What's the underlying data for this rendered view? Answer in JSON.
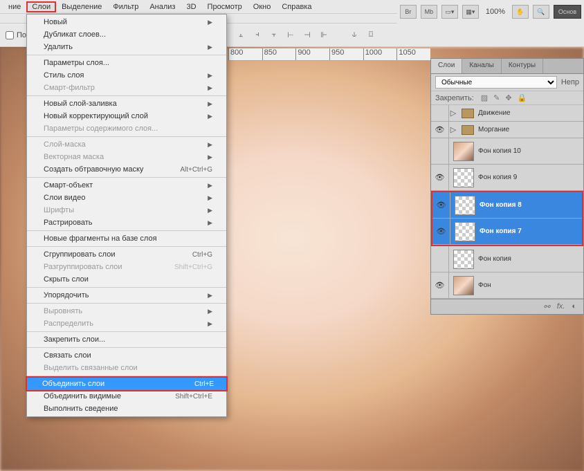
{
  "menubar": {
    "items": [
      "ние",
      "Слои",
      "Выделение",
      "Фильтр",
      "Анализ",
      "3D",
      "Просмотр",
      "Окно",
      "Справка"
    ],
    "active_index": 1
  },
  "toolbar_right": {
    "buttons": [
      "Br",
      "Mb"
    ],
    "zoom": "100%",
    "main_btn": "Основ"
  },
  "second_toolbar": {
    "checkbox_label": "Показ"
  },
  "ruler_ticks": [
    "800",
    "850",
    "900",
    "950",
    "1000",
    "1050"
  ],
  "dropdown": {
    "groups": [
      [
        {
          "label": "Новый",
          "arrow": true
        },
        {
          "label": "Дубликат слоев..."
        },
        {
          "label": "Удалить",
          "arrow": true
        }
      ],
      [
        {
          "label": "Параметры слоя..."
        },
        {
          "label": "Стиль слоя",
          "arrow": true
        },
        {
          "label": "Смарт-фильтр",
          "arrow": true,
          "disabled": true
        }
      ],
      [
        {
          "label": "Новый слой-заливка",
          "arrow": true
        },
        {
          "label": "Новый корректирующий слой",
          "arrow": true
        },
        {
          "label": "Параметры содержимого слоя...",
          "disabled": true
        }
      ],
      [
        {
          "label": "Слой-маска",
          "arrow": true,
          "disabled": true
        },
        {
          "label": "Векторная маска",
          "arrow": true,
          "disabled": true
        },
        {
          "label": "Создать обтравочную маску",
          "shortcut": "Alt+Ctrl+G"
        }
      ],
      [
        {
          "label": "Смарт-объект",
          "arrow": true
        },
        {
          "label": "Слои видео",
          "arrow": true
        },
        {
          "label": "Шрифты",
          "arrow": true,
          "disabled": true
        },
        {
          "label": "Растрировать",
          "arrow": true
        }
      ],
      [
        {
          "label": "Новые фрагменты на базе слоя"
        }
      ],
      [
        {
          "label": "Сгруппировать слои",
          "shortcut": "Ctrl+G"
        },
        {
          "label": "Разгруппировать слои",
          "shortcut": "Shift+Ctrl+G",
          "disabled": true
        },
        {
          "label": "Скрыть слои"
        }
      ],
      [
        {
          "label": "Упорядочить",
          "arrow": true
        }
      ],
      [
        {
          "label": "Выровнять",
          "arrow": true,
          "disabled": true
        },
        {
          "label": "Распределить",
          "arrow": true,
          "disabled": true
        }
      ],
      [
        {
          "label": "Закрепить слои..."
        }
      ],
      [
        {
          "label": "Связать слои"
        },
        {
          "label": "Выделить связанные слои",
          "disabled": true
        }
      ],
      [
        {
          "label": "Объединить слои",
          "shortcut": "Ctrl+E",
          "highlighted": true
        },
        {
          "label": "Объединить видимые",
          "shortcut": "Shift+Ctrl+E"
        },
        {
          "label": "Выполнить сведение"
        }
      ]
    ]
  },
  "layers_panel": {
    "tabs": [
      "Слои",
      "Каналы",
      "Контуры"
    ],
    "blend_mode": "Обычные",
    "opacity_label": "Непр",
    "lock_label": "Закрепить:",
    "layers": [
      {
        "type": "group",
        "name": "Движение",
        "visible": false
      },
      {
        "type": "group",
        "name": "Моргание",
        "visible": true
      },
      {
        "type": "layer",
        "name": "Фон копия 10",
        "thumb": "photo",
        "visible": false
      },
      {
        "type": "layer",
        "name": "Фон копия 9",
        "thumb": "checker",
        "visible": true
      },
      {
        "type": "layer",
        "name": "Фон копия 8",
        "thumb": "checker",
        "visible": true,
        "selected": true
      },
      {
        "type": "layer",
        "name": "Фон копия 7",
        "thumb": "checker",
        "visible": true,
        "selected": true
      },
      {
        "type": "layer",
        "name": "Фон копия",
        "thumb": "checker",
        "visible": false
      },
      {
        "type": "layer",
        "name": "Фон",
        "thumb": "photo",
        "visible": true
      }
    ]
  }
}
